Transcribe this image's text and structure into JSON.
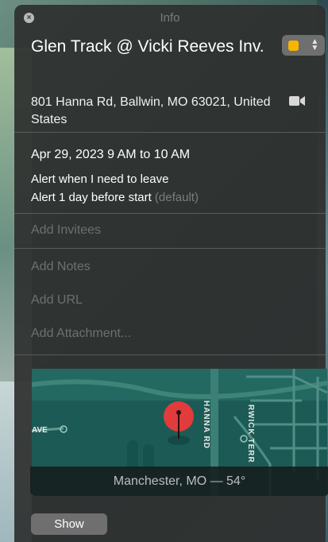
{
  "panel": {
    "title": "Info"
  },
  "event": {
    "title": "Glen Track @ Vicki Reeves Inv.",
    "color": "#f7b500",
    "location": "801 Hanna Rd, Ballwin, MO  63021, United States",
    "datetime": "Apr 29, 2023  9 AM to 10 AM",
    "alert_leave": "Alert when I need to leave",
    "alert_before": "Alert 1 day before start",
    "alert_before_suffix": "(default)"
  },
  "fields": {
    "invitees_placeholder": "Add Invitees",
    "notes_placeholder": "Add Notes",
    "url_placeholder": "Add URL",
    "attachment_placeholder": "Add Attachment..."
  },
  "map": {
    "street_hanna": "HANNA RD",
    "street_warwick": "RWICK TERR",
    "street_ave": "AVE",
    "caption": "Manchester, MO — 54°"
  },
  "actions": {
    "show_label": "Show"
  }
}
